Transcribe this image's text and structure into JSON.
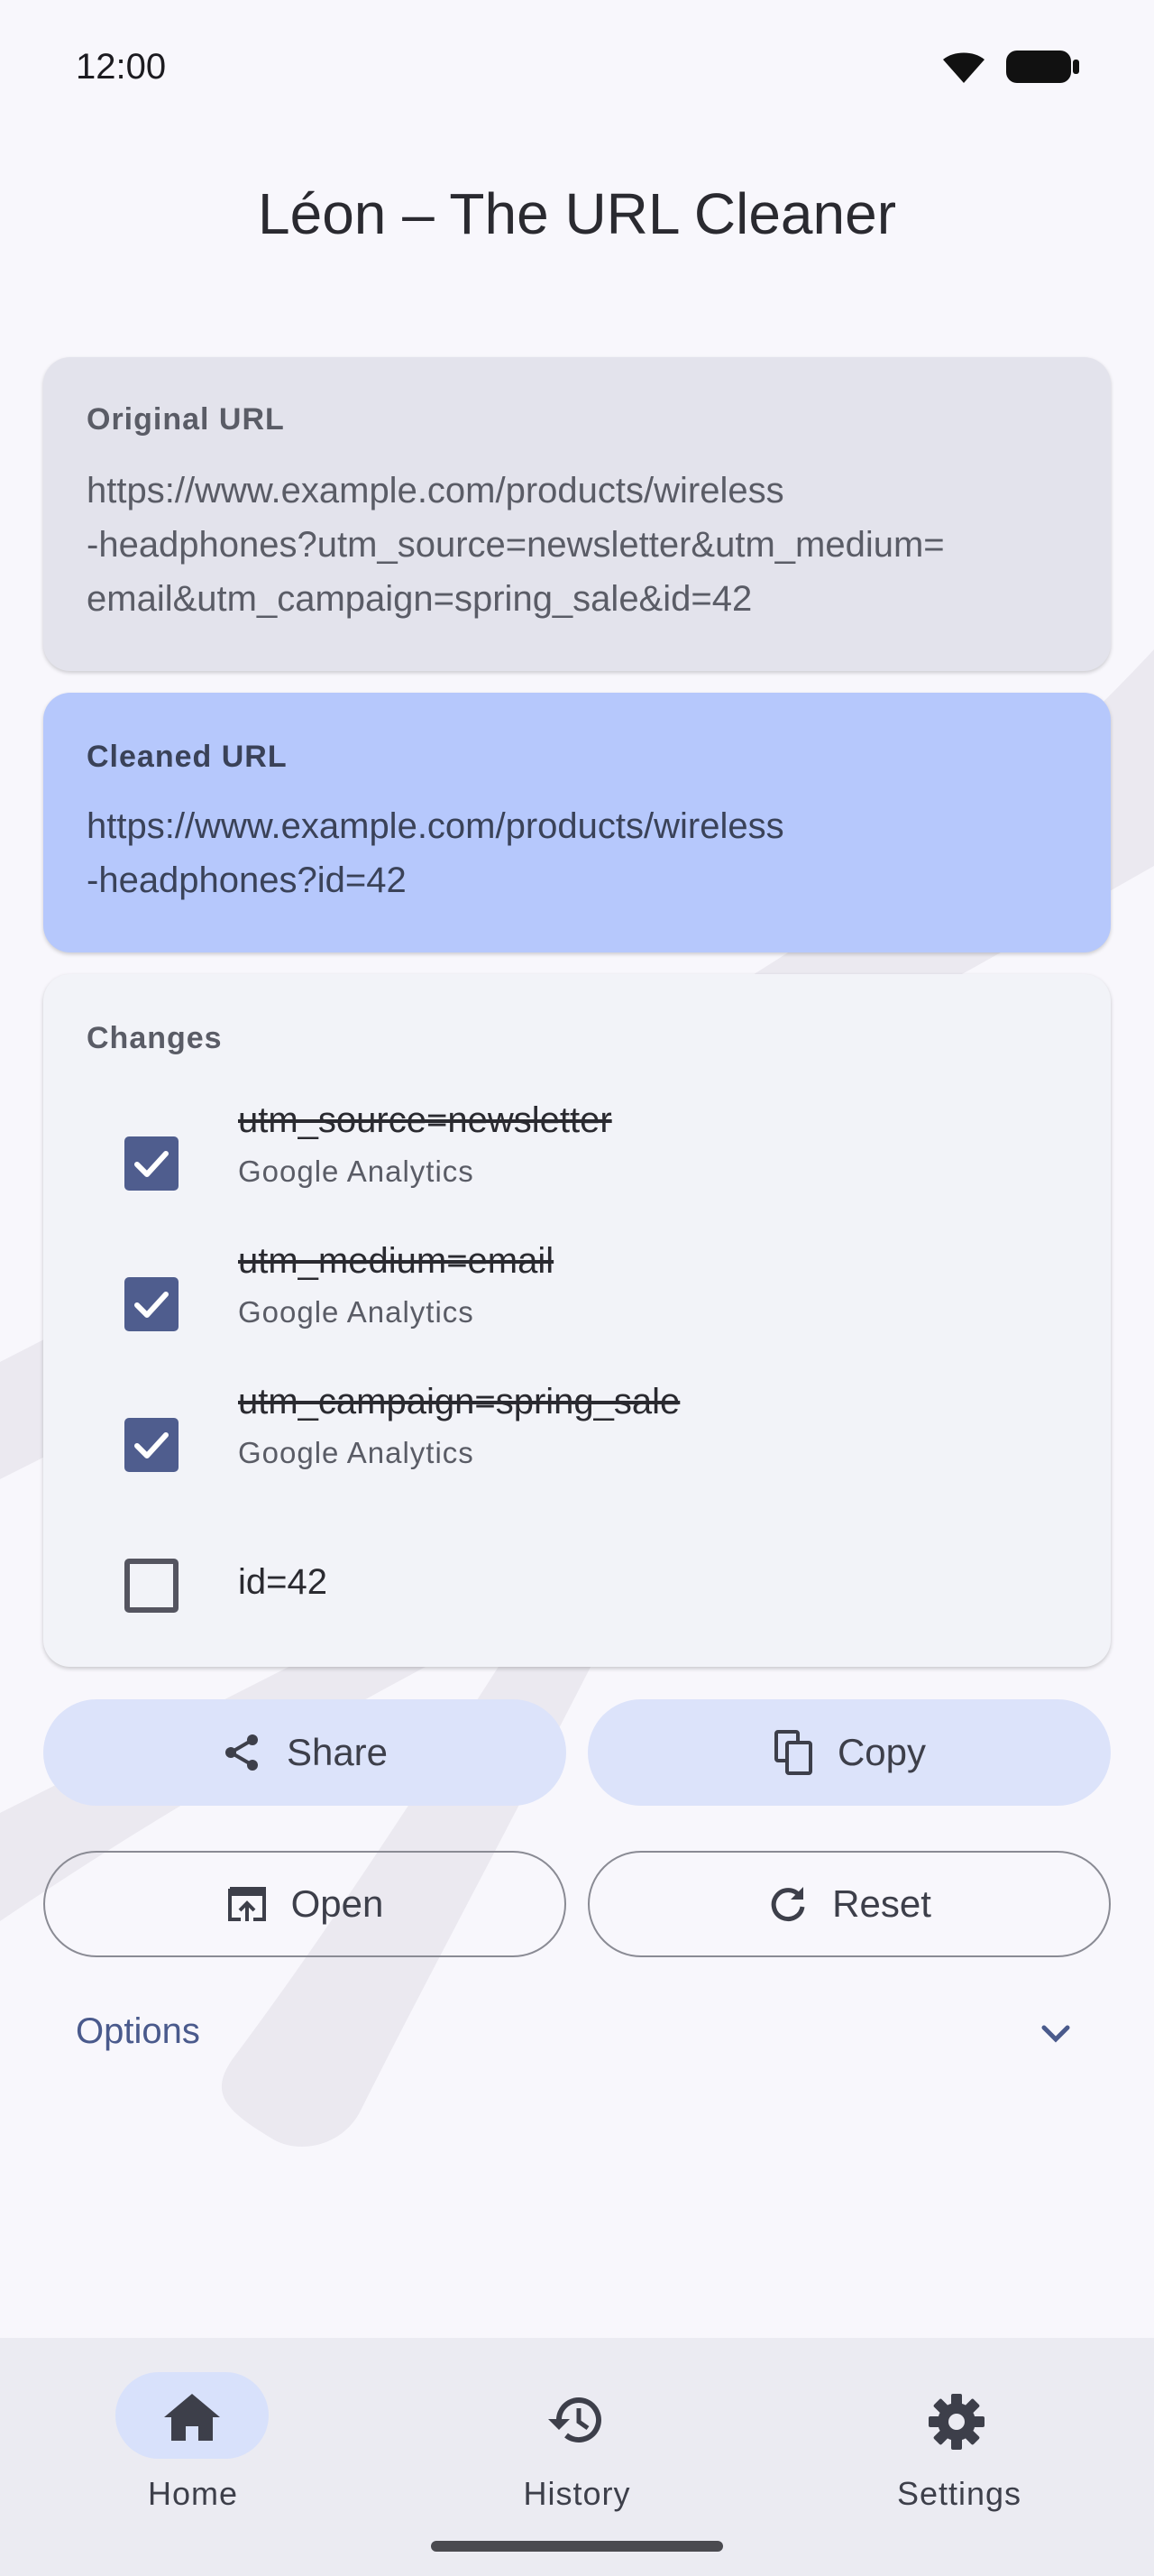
{
  "status": {
    "time": "12:00"
  },
  "app": {
    "title": "Léon – The URL Cleaner"
  },
  "original": {
    "label": "Original URL",
    "url": "https://www.example.com/products/wireless\n-headphones?utm_source=newsletter&utm_medium=\nemail&utm_campaign=spring_sale&id=42"
  },
  "cleaned": {
    "label": "Cleaned URL",
    "url": "https://www.example.com/products/wireless\n-headphones?id=42"
  },
  "changes": {
    "label": "Changes",
    "items": [
      {
        "param": "utm_source=newsletter",
        "provider": "Google Analytics",
        "checked": true
      },
      {
        "param": "utm_medium=email",
        "provider": "Google Analytics",
        "checked": true
      },
      {
        "param": "utm_campaign=spring_sale",
        "provider": "Google Analytics",
        "checked": true
      },
      {
        "param": "id=42",
        "provider": "",
        "checked": false
      }
    ]
  },
  "actions": {
    "share": "Share",
    "copy": "Copy",
    "open": "Open",
    "reset": "Reset"
  },
  "options": {
    "label": "Options"
  },
  "nav": {
    "items": [
      {
        "label": "Home",
        "icon": "home-icon",
        "active": true
      },
      {
        "label": "History",
        "icon": "history-icon",
        "active": false
      },
      {
        "label": "Settings",
        "icon": "settings-icon",
        "active": false
      }
    ]
  },
  "colors": {
    "background": "#f8f7fc",
    "original_card": "#e3e3ec",
    "cleaned_card": "#b6c8fc",
    "changes_card": "#f2f3f8",
    "checkbox": "#4f5d8e",
    "tonal_button": "#dce3fa",
    "accent_text": "#4a5a8c",
    "navbar": "#ebebf2",
    "nav_active_pill": "#d8e1fb"
  }
}
